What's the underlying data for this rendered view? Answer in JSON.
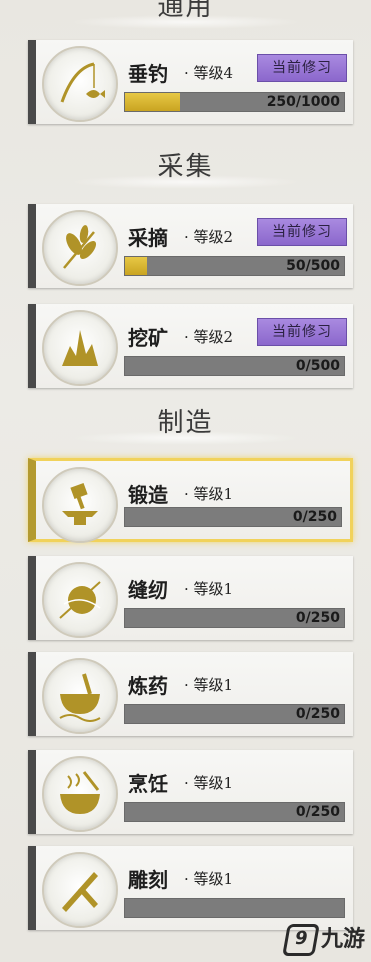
{
  "sections": {
    "general": "通用",
    "gather": "采集",
    "craft": "制造"
  },
  "skills": [
    {
      "name": "垂钓",
      "level": "· 等级4",
      "progress": "250/1000",
      "fraction": 0.25,
      "current_label": "当前修习",
      "icon": "fishing-icon"
    },
    {
      "name": "采摘",
      "level": "· 等级2",
      "progress": "50/500",
      "fraction": 0.1,
      "current_label": "当前修习",
      "icon": "herb-icon"
    },
    {
      "name": "挖矿",
      "level": "· 等级2",
      "progress": "0/500",
      "fraction": 0,
      "current_label": "当前修习",
      "icon": "mining-icon"
    },
    {
      "name": "锻造",
      "level": "· 等级1",
      "progress": "0/250",
      "fraction": 0,
      "icon": "anvil-icon"
    },
    {
      "name": "缝纫",
      "level": "· 等级1",
      "progress": "0/250",
      "fraction": 0,
      "icon": "sewing-icon"
    },
    {
      "name": "炼药",
      "level": "· 等级1",
      "progress": "0/250",
      "fraction": 0,
      "icon": "mortar-icon"
    },
    {
      "name": "烹饪",
      "level": "· 等级1",
      "progress": "0/250",
      "fraction": 0,
      "icon": "cooking-icon"
    },
    {
      "name": "雕刻",
      "level": "· 等级1",
      "progress": "",
      "fraction": 0,
      "icon": "carving-icon"
    }
  ],
  "watermark": {
    "text": "九游",
    "logo": "9"
  },
  "colors": {
    "accent_gold": "#e7c845",
    "badge_purple": "#9b7bd6",
    "selected_border": "#f1d25b"
  }
}
